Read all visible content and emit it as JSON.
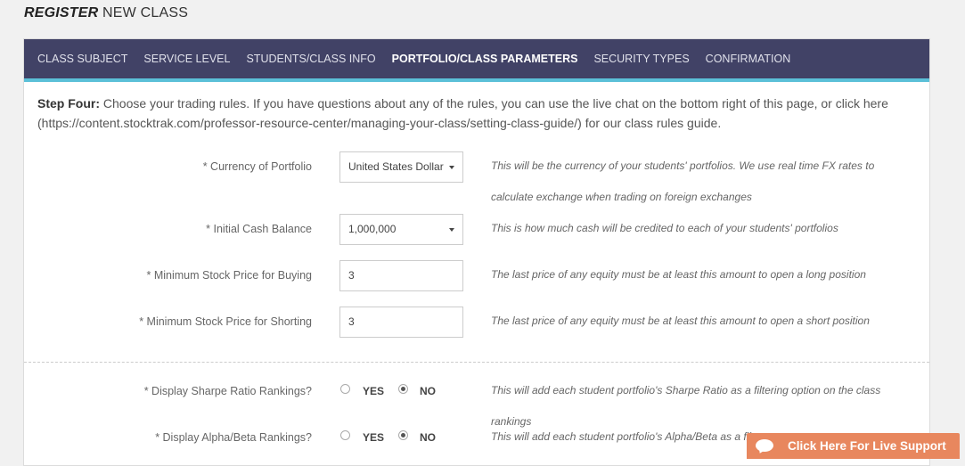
{
  "page": {
    "title_strong": "REGISTER",
    "title_rest": " NEW CLASS"
  },
  "tabs": [
    {
      "label": "CLASS SUBJECT",
      "active": false
    },
    {
      "label": "SERVICE LEVEL",
      "active": false
    },
    {
      "label": "STUDENTS/CLASS INFO",
      "active": false
    },
    {
      "label": "PORTFOLIO/CLASS PARAMETERS",
      "active": true
    },
    {
      "label": "SECURITY TYPES",
      "active": false
    },
    {
      "label": "CONFIRMATION",
      "active": false
    }
  ],
  "intro": {
    "step": "Step Four:",
    "text": " Choose your trading rules. If you have questions about any of the rules, you can use the live chat on the bottom right of this page, or click here (https://content.stocktrak.com/professor-resource-center/managing-your-class/setting-class-guide/) for our class rules guide."
  },
  "fields": {
    "currency": {
      "label": "* Currency of Portfolio",
      "value": "United States Dollar",
      "help": "This will be the currency of your students' portfolios. We use real time FX rates to calculate exchange when trading on foreign exchanges"
    },
    "cash": {
      "label": "* Initial Cash Balance",
      "value": "1,000,000",
      "help": "This is how much cash will be credited to each of your students' portfolios"
    },
    "min_buy": {
      "label": "* Minimum Stock Price for Buying",
      "value": "3",
      "help": "The last price of any equity must be at least this amount to open a long position"
    },
    "min_short": {
      "label": "* Minimum Stock Price for Shorting",
      "value": "3",
      "help": "The last price of any equity must be at least this amount to open a short position"
    },
    "sharpe": {
      "label": "* Display Sharpe Ratio Rankings?",
      "yes": "YES",
      "no": "NO",
      "selected": "NO",
      "help": "This will add each student portfolio's Sharpe Ratio as a filtering option on the class rankings"
    },
    "alpha": {
      "label": "* Display Alpha/Beta Rankings?",
      "yes": "YES",
      "no": "NO",
      "selected": "NO",
      "help": "This will add each student portfolio's Alpha/Beta as a filt"
    }
  },
  "support": {
    "label": "Click Here For Live Support",
    "color": "#e8875e"
  },
  "colors": {
    "tabbar": "#414266",
    "tab_underline": "#5bc0d8"
  }
}
